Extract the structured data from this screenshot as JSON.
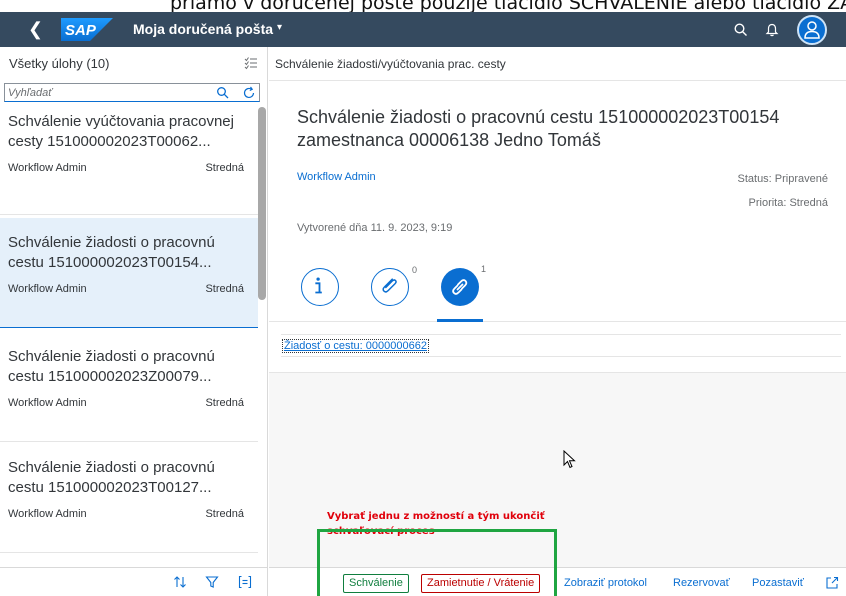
{
  "doc_strip_text": "priamo v doručenej pošte použije tlačidlo SCHVÁLENIE alebo tlačidlo ZA",
  "shell": {
    "back_icon": "chevron-left-icon",
    "logo_text": "SAP",
    "title": "Moja doručená pošta",
    "caret": "▾",
    "icons": [
      "search-icon",
      "bell-icon",
      "user-icon"
    ]
  },
  "left": {
    "header_title": "Všetky úlohy (10)",
    "search_placeholder": "Vyhľadať",
    "items": [
      {
        "title": "Schválenie vyúčtovania pracovnej cesty 151000002023T00062...",
        "owner": "Workflow Admin",
        "priority": "Stredná"
      },
      {
        "title": "Schválenie žiadosti o pracovnú cestu 151000002023T00154...",
        "owner": "Workflow Admin",
        "priority": "Stredná"
      },
      {
        "title": "Schválenie žiadosti o pracovnú cestu 151000002023Z00079...",
        "owner": "Workflow Admin",
        "priority": "Stredná"
      },
      {
        "title": "Schválenie žiadosti o pracovnú cestu 151000002023T00127...",
        "owner": "Workflow Admin",
        "priority": "Stredná"
      }
    ],
    "footer_icons": [
      "sort-icon",
      "filter-icon",
      "group-icon"
    ]
  },
  "detail": {
    "header": "Schválenie žiadosti/vyúčtovania prac. cesty",
    "title": "Schválenie žiadosti o pracovnú cestu 151000002023T00154 zamestnanca 00006138 Jedno Tomáš",
    "workflow": "Workflow Admin",
    "status": "Status: Pripravené",
    "priority": "Priorita: Stredná",
    "created": "Vytvorené dňa 11. 9. 2023, 9:19",
    "tabs": {
      "info_icon": "info-icon",
      "attachments_icon": "paperclip-icon",
      "attachments_count": "0",
      "links_icon": "link-icon",
      "links_count": "1"
    },
    "link_text": "Žiadosť o cestu: 0000000662",
    "annotation": "Vybrať jednu z možností a tým ukončiť schvaľovací proces"
  },
  "footer": {
    "approve": "Schválenie",
    "reject": "Zamietnutie / Vrátenie",
    "log": "Zobraziť protokol",
    "reserve": "Rezervovať",
    "suspend": "Pozastaviť",
    "share_icon": "share-icon"
  },
  "colors": {
    "shell": "#354a5f",
    "accent": "#0a6ed1",
    "approve": "#107e3e",
    "reject": "#bb0000",
    "annotation": "#e0000b",
    "highlight_box": "#1fa541"
  }
}
